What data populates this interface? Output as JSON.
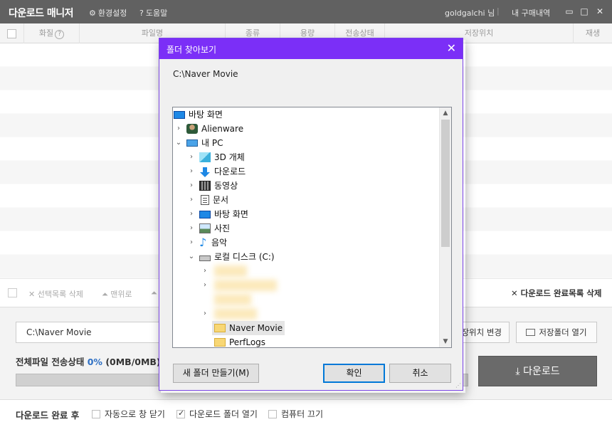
{
  "window": {
    "title": "다운로드 매니저",
    "menu_settings": "환경설정",
    "menu_help": "도움말",
    "user_name": "goldgalchi 님",
    "separator": "|",
    "purchase_history": "내 구매내역",
    "win_min": "▭",
    "win_max": "□",
    "win_close": "✕"
  },
  "columns": [
    "화질",
    "파일명",
    "종류",
    "용량",
    "전송상태",
    "저장위치",
    "재생"
  ],
  "toolbar": {
    "delete_selected": "✕ 선택목록 삭제",
    "move_top": "⏶ 맨위로",
    "move_up": "⏶",
    "delete_completed": "✕ 다운로드 완료목록 삭제"
  },
  "bottom": {
    "save_path": "C:\\Naver Movie",
    "change_location": "장위치 변경",
    "open_folder": "저장폴더 열기",
    "status_label": "전체파일 전송상태",
    "status_percent": "0%",
    "status_size": "(0MB/0MB)",
    "progress": 0,
    "download_button": "다운로드"
  },
  "footer": {
    "label": "다운로드 완료 후",
    "options": [
      {
        "label": "자동으로 창 닫기",
        "checked": false
      },
      {
        "label": "다운로드 폴더 열기",
        "checked": true
      },
      {
        "label": "컴퓨터 끄기",
        "checked": false
      }
    ]
  },
  "dialog": {
    "title": "폴더 찾아보기",
    "close": "✕",
    "current_path": "C:\\Naver Movie",
    "tree": [
      {
        "label": "바탕 화면",
        "icon": "desktop-icon"
      },
      {
        "label": "Alienware",
        "icon": "user-icon"
      },
      {
        "label": "내 PC",
        "icon": "pc-icon"
      },
      {
        "label": "3D 개체",
        "icon": "3d-objects-icon"
      },
      {
        "label": "다운로드",
        "icon": "download-icon"
      },
      {
        "label": "동영상",
        "icon": "video-icon"
      },
      {
        "label": "문서",
        "icon": "documents-icon"
      },
      {
        "label": "바탕 화면",
        "icon": "desktop-icon"
      },
      {
        "label": "사진",
        "icon": "pictures-icon"
      },
      {
        "label": "음악",
        "icon": "music-icon"
      },
      {
        "label": "로컬 디스크 (C:)",
        "icon": "drive-icon"
      },
      {
        "label": "Naver Movie",
        "icon": "folder-icon",
        "selected": true
      },
      {
        "label": "PerfLogs",
        "icon": "folder-icon"
      }
    ],
    "new_folder": "새 폴더 만들기(M)",
    "ok": "확인",
    "cancel": "취소"
  },
  "colors": {
    "titlebar": "#616161",
    "dialog_accent": "#7b2ff7",
    "percent_blue": "#2d6fc4"
  }
}
